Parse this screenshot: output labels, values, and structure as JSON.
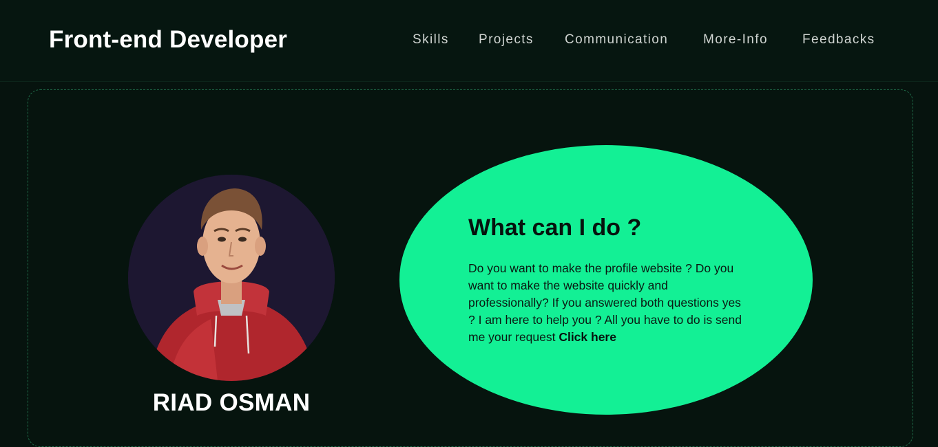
{
  "header": {
    "brand": "Front-end Developer",
    "nav": [
      {
        "label": "Skills"
      },
      {
        "label": "Projects"
      },
      {
        "label": "Communication"
      },
      {
        "label": "More-Info"
      },
      {
        "label": "Feedbacks"
      }
    ]
  },
  "hero": {
    "name": "RIAD OSMAN",
    "avatar_icon": "developer-portrait",
    "bubble": {
      "title": "What can I do ?",
      "text": "Do you want to make the profile website ? Do you want to make the website quickly and professionally? If you answered both questions yes ? I am here to help you ? All you have to do is send me your request ",
      "cta": "Click here"
    }
  },
  "colors": {
    "background": "#06130e",
    "accent": "#13f095",
    "text": "#ffffff"
  }
}
